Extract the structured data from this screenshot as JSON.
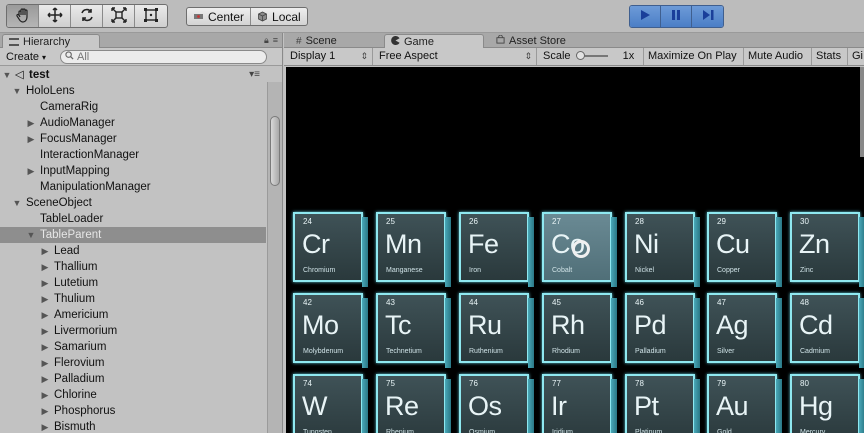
{
  "toolbar": {
    "tools": [
      {
        "icon": "hand-icon"
      },
      {
        "icon": "move-icon"
      },
      {
        "icon": "rotate-icon"
      },
      {
        "icon": "scale-icon"
      },
      {
        "icon": "rect-tool-icon"
      }
    ],
    "pivot": {
      "center_label": "Center",
      "local_label": "Local"
    },
    "playback": {
      "play_icon": "play-icon",
      "pause_icon": "pause-icon",
      "step_icon": "step-icon"
    }
  },
  "hierarchy": {
    "tab_label": "Hierarchy",
    "create_label": "Create",
    "search_placeholder": "All",
    "scene_name": "test",
    "items": [
      {
        "label": "HoloLens",
        "depth": 1,
        "arrow": "▼"
      },
      {
        "label": "CameraRig",
        "depth": 2,
        "arrow": ""
      },
      {
        "label": "AudioManager",
        "depth": 2,
        "arrow": "▶"
      },
      {
        "label": "FocusManager",
        "depth": 2,
        "arrow": "▶"
      },
      {
        "label": "InteractionManager",
        "depth": 2,
        "arrow": ""
      },
      {
        "label": "InputMapping",
        "depth": 2,
        "arrow": "▶"
      },
      {
        "label": "ManipulationManager",
        "depth": 2,
        "arrow": ""
      },
      {
        "label": "SceneObject",
        "depth": 1,
        "arrow": "▼"
      },
      {
        "label": "TableLoader",
        "depth": 2,
        "arrow": ""
      },
      {
        "label": "TableParent",
        "depth": 2,
        "arrow": "▼",
        "selected": true
      },
      {
        "label": "Lead",
        "depth": 3,
        "arrow": "▶"
      },
      {
        "label": "Thallium",
        "depth": 3,
        "arrow": "▶"
      },
      {
        "label": "Lutetium",
        "depth": 3,
        "arrow": "▶"
      },
      {
        "label": "Thulium",
        "depth": 3,
        "arrow": "▶"
      },
      {
        "label": "Americium",
        "depth": 3,
        "arrow": "▶"
      },
      {
        "label": "Livermorium",
        "depth": 3,
        "arrow": "▶"
      },
      {
        "label": "Samarium",
        "depth": 3,
        "arrow": "▶"
      },
      {
        "label": "Flerovium",
        "depth": 3,
        "arrow": "▶"
      },
      {
        "label": "Palladium",
        "depth": 3,
        "arrow": "▶"
      },
      {
        "label": "Chlorine",
        "depth": 3,
        "arrow": "▶"
      },
      {
        "label": "Phosphorus",
        "depth": 3,
        "arrow": "▶"
      },
      {
        "label": "Bismuth",
        "depth": 3,
        "arrow": "▶"
      }
    ]
  },
  "game": {
    "tabs": {
      "scene": "Scene",
      "game": "Game",
      "asset_store": "Asset Store"
    },
    "bar": {
      "display": "Display 1",
      "aspect": "Free Aspect",
      "scale_label": "Scale",
      "scale_value": "1x",
      "maximize": "Maximize On Play",
      "mute": "Mute Audio",
      "stats": "Stats",
      "gizmos": "Gi"
    },
    "elements": [
      [
        {
          "num": "24",
          "sym": "Cr",
          "name": "Chromium"
        },
        {
          "num": "25",
          "sym": "Mn",
          "name": "Manganese"
        },
        {
          "num": "26",
          "sym": "Fe",
          "name": "Iron"
        },
        {
          "num": "27",
          "sym": "Co",
          "name": "Cobalt",
          "highlighted": true
        },
        {
          "num": "28",
          "sym": "Ni",
          "name": "Nickel"
        },
        {
          "num": "29",
          "sym": "Cu",
          "name": "Copper"
        },
        {
          "num": "30",
          "sym": "Zn",
          "name": "Zinc"
        }
      ],
      [
        {
          "num": "42",
          "sym": "Mo",
          "name": "Molybdenum"
        },
        {
          "num": "43",
          "sym": "Tc",
          "name": "Technetium"
        },
        {
          "num": "44",
          "sym": "Ru",
          "name": "Ruthenium"
        },
        {
          "num": "45",
          "sym": "Rh",
          "name": "Rhodium"
        },
        {
          "num": "46",
          "sym": "Pd",
          "name": "Palladium"
        },
        {
          "num": "47",
          "sym": "Ag",
          "name": "Silver"
        },
        {
          "num": "48",
          "sym": "Cd",
          "name": "Cadmium"
        }
      ],
      [
        {
          "num": "74",
          "sym": "W",
          "name": "Tungsten"
        },
        {
          "num": "75",
          "sym": "Re",
          "name": "Rhenium"
        },
        {
          "num": "76",
          "sym": "Os",
          "name": "Osmium"
        },
        {
          "num": "77",
          "sym": "Ir",
          "name": "Iridium"
        },
        {
          "num": "78",
          "sym": "Pt",
          "name": "Platinum"
        },
        {
          "num": "79",
          "sym": "Au",
          "name": "Gold"
        },
        {
          "num": "80",
          "sym": "Hg",
          "name": "Mercury"
        }
      ]
    ]
  }
}
